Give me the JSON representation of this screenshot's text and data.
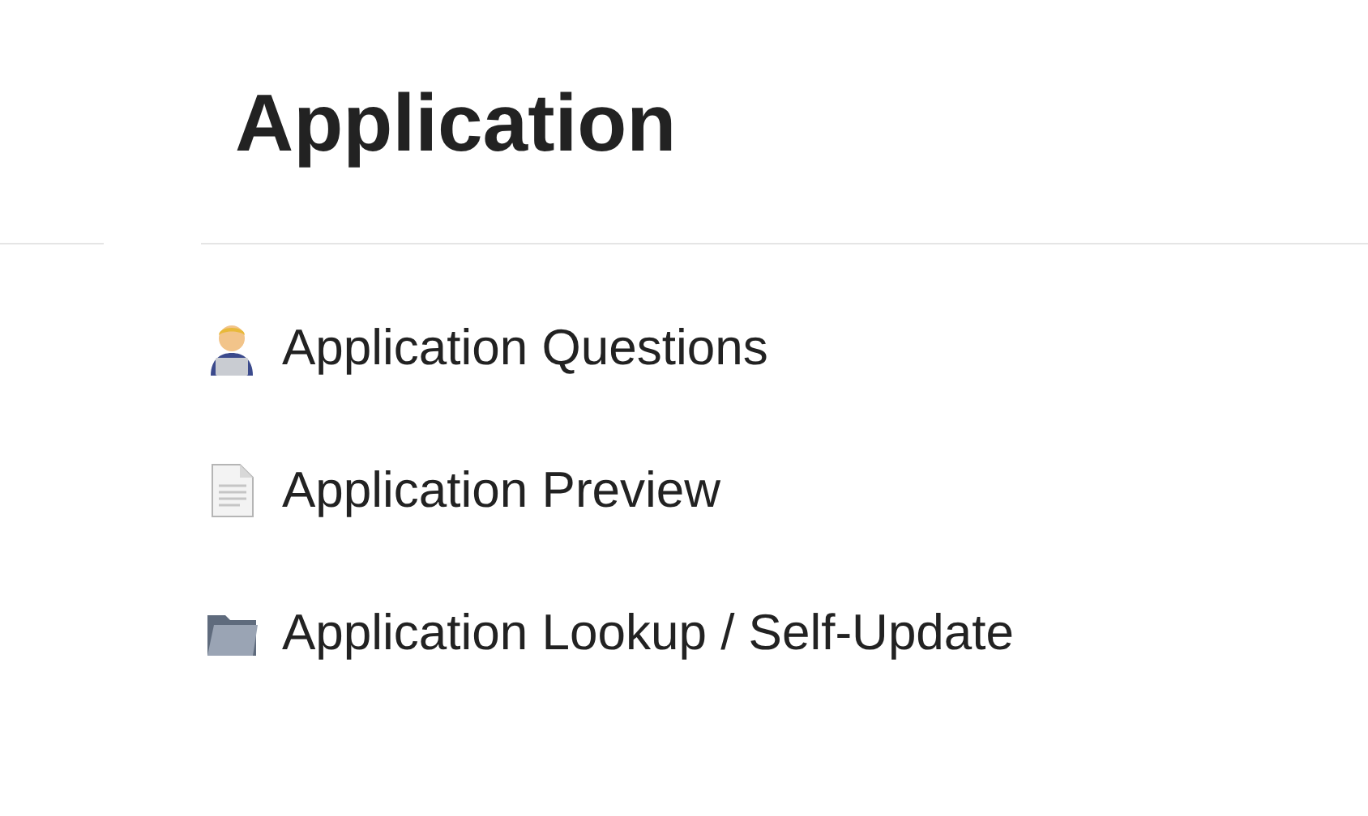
{
  "heading": "Application",
  "items": [
    {
      "kind": "person",
      "label": "Application Questions"
    },
    {
      "kind": "page",
      "label": "Application Preview"
    },
    {
      "kind": "folder",
      "label": "Application Lookup / Self-Update"
    }
  ]
}
